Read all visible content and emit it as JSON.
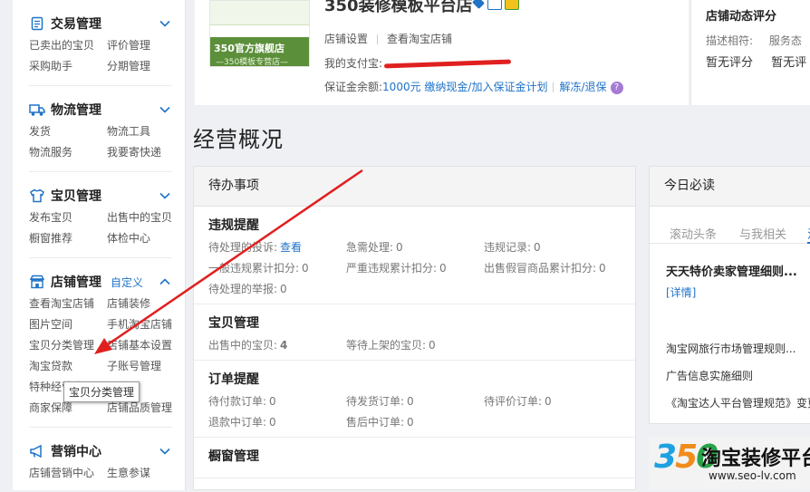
{
  "sidebar": {
    "sections": [
      {
        "title": "交易管理",
        "icon": "document-icon",
        "links": [
          "已卖出的宝贝",
          "评价管理",
          "采购助手",
          "分期管理"
        ]
      },
      {
        "title": "物流管理",
        "icon": "truck-icon",
        "links": [
          "发货",
          "物流工具",
          "物流服务",
          "我要寄快递"
        ]
      },
      {
        "title": "宝贝管理",
        "icon": "tshirt-icon",
        "links": [
          "发布宝贝",
          "出售中的宝贝",
          "橱窗推荐",
          "体检中心"
        ]
      },
      {
        "title": "店铺管理",
        "icon": "store-icon",
        "custom": "自定义",
        "links": [
          "查看淘宝店铺",
          "店铺装修",
          "图片空间",
          "手机淘宝店铺",
          "宝贝分类管理",
          "店铺基本设置",
          "淘宝贷款",
          "子账号管理",
          "特种经营许可证规则",
          "",
          "商家保障",
          "店铺品质管理"
        ]
      },
      {
        "title": "营销中心",
        "icon": "megaphone-icon",
        "links": [
          "店铺营销中心",
          "生意参谋"
        ]
      }
    ],
    "tooltip": "宝贝分类管理"
  },
  "shop": {
    "name": "350装修模板平台店",
    "logo_line1": "350官方旗舰店",
    "logo_line2": "—350模板专营店—",
    "link1": "店铺设置",
    "link2": "查看淘宝店铺",
    "alipay_label": "我的支付宝:",
    "deposit_label": "保证金余额:",
    "deposit_amount": "1000元",
    "deposit_action": "缴纳现金/加入保证金计划",
    "deposit_refund": "解冻/退保",
    "help": "?"
  },
  "rating": {
    "title": "店铺动态评分",
    "label1": "描述相符:",
    "label2": "服务态",
    "value1": "暂无评分",
    "value2": "暂无评"
  },
  "page_title": "经营概况",
  "todo": {
    "title": "待办事项",
    "groups": [
      {
        "title": "违规提醒",
        "items": [
          {
            "label": "待处理的投诉:",
            "value": "查看",
            "type": "link"
          },
          {
            "label": "急需处理:",
            "value": "0"
          },
          {
            "label": "违规记录:",
            "value": "0"
          },
          {
            "label": "一般违规累计扣分:",
            "value": "0"
          },
          {
            "label": "严重违规累计扣分:",
            "value": "0"
          },
          {
            "label": "出售假冒商品累计扣分:",
            "value": "0"
          },
          {
            "label": "待处理的举报:",
            "value": "0"
          }
        ]
      },
      {
        "title": "宝贝管理",
        "items": [
          {
            "label": "出售中的宝贝:",
            "value": "4",
            "type": "red"
          },
          {
            "label": "等待上架的宝贝:",
            "value": "0"
          }
        ]
      },
      {
        "title": "订单提醒",
        "items": [
          {
            "label": "待付款订单:",
            "value": "0"
          },
          {
            "label": "待发货订单:",
            "value": "0"
          },
          {
            "label": "待评价订单:",
            "value": "0"
          },
          {
            "label": "退款中订单:",
            "value": "0"
          },
          {
            "label": "售后中订单:",
            "value": "0"
          }
        ]
      },
      {
        "title": "橱窗管理",
        "items": []
      }
    ]
  },
  "today": {
    "title": "今日必读",
    "tab1": "滚动头条",
    "tab2": "与我相关",
    "tab3": "活",
    "headline": "天天特价卖家管理细则...",
    "detail": "[详情]",
    "news1": "淘宝网旅行市场管理规则...",
    "news2": "广告信息实施细则",
    "news3": "《淘宝达人平台管理规范》变更..."
  },
  "watermark": {
    "logo": "350",
    "text": "淘宝装修平台",
    "url": "www.seo-lv.com"
  },
  "colors": {
    "link": "#1f73c8",
    "accent_red": "#f04e23",
    "arrow": "#e02020"
  }
}
